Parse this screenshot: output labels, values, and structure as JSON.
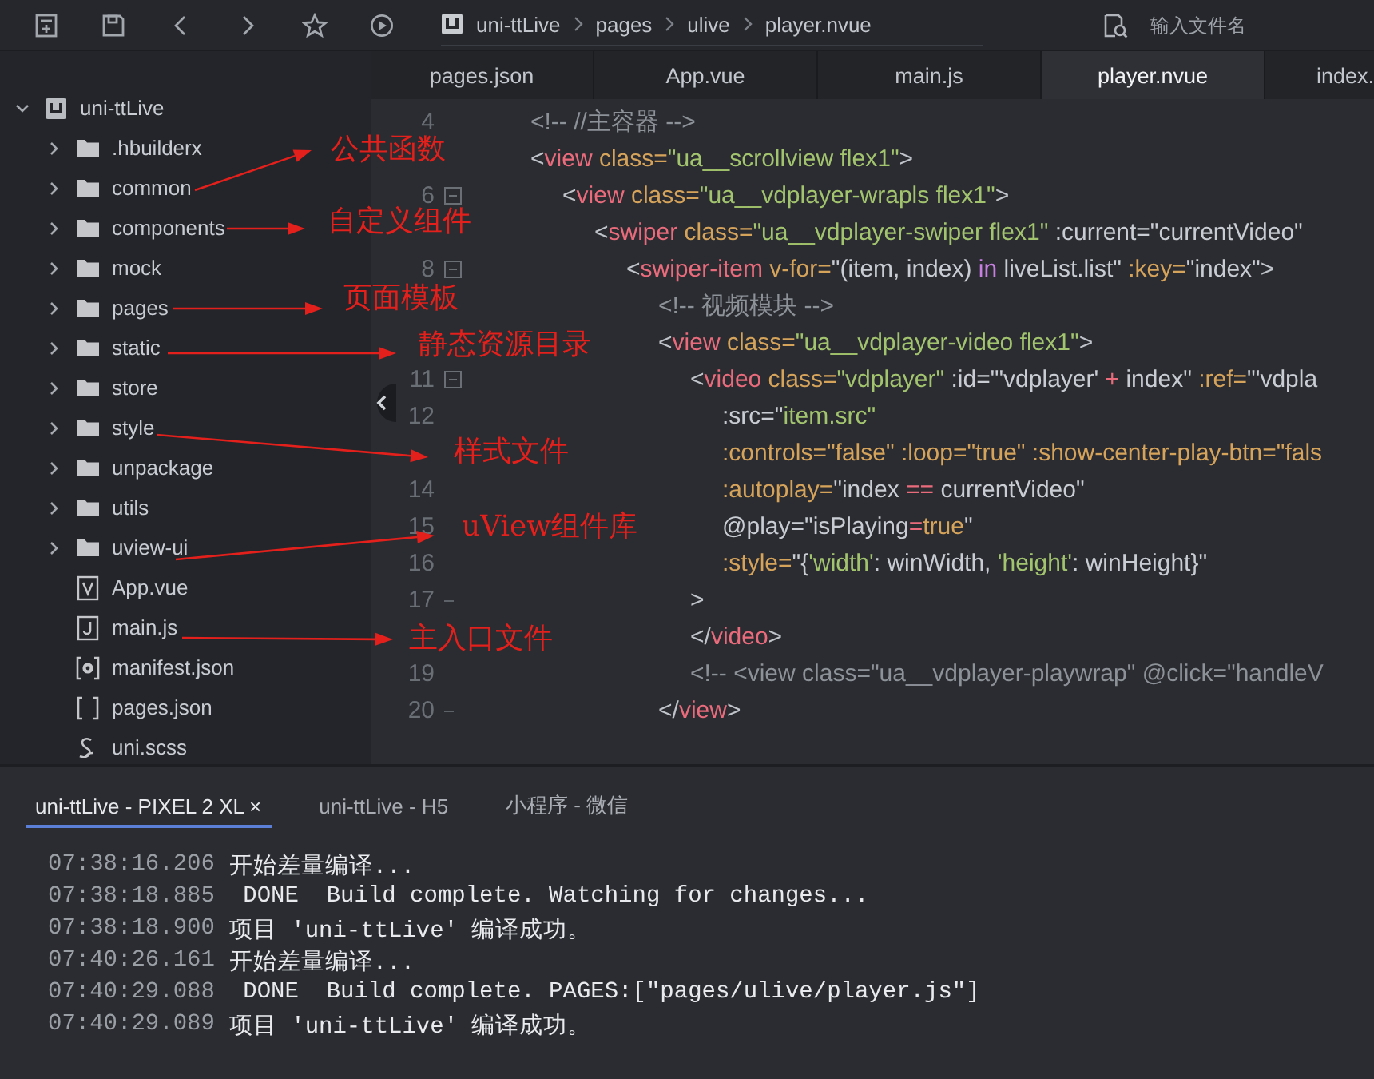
{
  "toolbar": {
    "breadcrumb": [
      "uni-ttLive",
      "pages",
      "ulive",
      "player.nvue"
    ],
    "search": {
      "placeholder": "输入文件名"
    }
  },
  "file_tree": {
    "name": "uni-ttLive",
    "kind": "project",
    "expanded": true,
    "children": [
      {
        "name": ".hbuilderx",
        "kind": "folder",
        "expanded": false
      },
      {
        "name": "common",
        "kind": "folder",
        "expanded": false
      },
      {
        "name": "components",
        "kind": "folder",
        "expanded": false
      },
      {
        "name": "mock",
        "kind": "folder",
        "expanded": false
      },
      {
        "name": "pages",
        "kind": "folder",
        "expanded": false
      },
      {
        "name": "static",
        "kind": "folder",
        "expanded": false
      },
      {
        "name": "store",
        "kind": "folder",
        "expanded": false
      },
      {
        "name": "style",
        "kind": "folder",
        "expanded": false
      },
      {
        "name": "unpackage",
        "kind": "folder",
        "expanded": false
      },
      {
        "name": "utils",
        "kind": "folder",
        "expanded": false
      },
      {
        "name": "uview-ui",
        "kind": "folder",
        "expanded": false
      },
      {
        "name": "App.vue",
        "kind": "vue"
      },
      {
        "name": "main.js",
        "kind": "js"
      },
      {
        "name": "manifest.json",
        "kind": "manifest"
      },
      {
        "name": "pages.json",
        "kind": "json"
      },
      {
        "name": "uni.scss",
        "kind": "scss"
      }
    ]
  },
  "editor_tabs": [
    {
      "label": "pages.json",
      "selected": false
    },
    {
      "label": "App.vue",
      "selected": false
    },
    {
      "label": "main.js",
      "selected": false
    },
    {
      "label": "player.nvue",
      "selected": true
    },
    {
      "label": "index.",
      "selected": false
    }
  ],
  "code_lines": [
    {
      "number": "4",
      "tokens": [
        {
          "kind": "comment",
          "text": "<!-- //主容器 -->"
        }
      ]
    },
    {
      "tokens": [
        {
          "kind": "punct",
          "text": "<"
        },
        {
          "kind": "tag",
          "text": "view"
        },
        {
          "kind": "attr",
          "text": " class="
        },
        {
          "kind": "str",
          "text": "\"ua__scrollview flex1\""
        },
        {
          "kind": "punct",
          "text": ">"
        }
      ],
      "children": [
        {
          "number": "6",
          "fold_open": true,
          "tokens": [
            {
              "kind": "punct",
              "text": "<"
            },
            {
              "kind": "tag",
              "text": "view"
            },
            {
              "kind": "attr",
              "text": " class="
            },
            {
              "kind": "str",
              "text": "\"ua__vdplayer-wrapls flex1\""
            },
            {
              "kind": "punct",
              "text": ">"
            }
          ],
          "children": [
            {
              "tokens": [
                {
                  "kind": "punct",
                  "text": "<"
                },
                {
                  "kind": "tag",
                  "text": "swiper"
                },
                {
                  "kind": "attr",
                  "text": " class="
                },
                {
                  "kind": "str",
                  "text": "\"ua__vdplayer-swiper flex1\""
                },
                {
                  "kind": "expr",
                  "text": " :current=\"currentVideo\""
                }
              ],
              "children": [
                {
                  "number": "8",
                  "fold_open": true,
                  "tokens": [
                    {
                      "kind": "punct",
                      "text": "<"
                    },
                    {
                      "kind": "tag",
                      "text": "swiper-item"
                    },
                    {
                      "kind": "attr",
                      "text": " v-for="
                    },
                    {
                      "kind": "expr",
                      "text": "\"(item, index) "
                    },
                    {
                      "kind": "kw",
                      "text": "in"
                    },
                    {
                      "kind": "expr",
                      "text": " liveList.list\""
                    },
                    {
                      "kind": "attr",
                      "text": " :key="
                    },
                    {
                      "kind": "expr",
                      "text": "\"index\""
                    },
                    {
                      "kind": "punct",
                      "text": ">"
                    }
                  ],
                  "children": [
                    {
                      "tokens": [
                        {
                          "kind": "comment",
                          "text": "<!-- 视频模块 -->"
                        }
                      ]
                    },
                    {
                      "tokens": [
                        {
                          "kind": "punct",
                          "text": "<"
                        },
                        {
                          "kind": "tag",
                          "text": "view"
                        },
                        {
                          "kind": "attr",
                          "text": " class="
                        },
                        {
                          "kind": "str",
                          "text": "\"ua__vdplayer-video flex1\""
                        },
                        {
                          "kind": "punct",
                          "text": ">"
                        }
                      ],
                      "children": [
                        {
                          "number": "11",
                          "fold_open": true,
                          "tokens": [
                            {
                              "kind": "punct",
                              "text": "<"
                            },
                            {
                              "kind": "tag",
                              "text": "video"
                            },
                            {
                              "kind": "attr",
                              "text": " class="
                            },
                            {
                              "kind": "str",
                              "text": "\"vdplayer\""
                            },
                            {
                              "kind": "expr",
                              "text": " :id=\"'vdplayer' "
                            },
                            {
                              "kind": "op",
                              "text": "+"
                            },
                            {
                              "kind": "expr",
                              "text": " index\""
                            },
                            {
                              "kind": "attr",
                              "text": " :ref="
                            },
                            {
                              "kind": "expr",
                              "text": "\"'vdpla"
                            }
                          ],
                          "children": [
                            {
                              "number": "12",
                              "tokens": [
                                {
                                  "kind": "expr",
                                  "text": ":src=\""
                                },
                                {
                                  "kind": "str",
                                  "text": "item.src\""
                                }
                              ]
                            },
                            {
                              "tokens": [
                                {
                                  "kind": "attr",
                                  "text": ":controls=\"false\" :loop=\"true\" :show-center-play-btn=\"fals"
                                }
                              ]
                            },
                            {
                              "number": "14",
                              "tokens": [
                                {
                                  "kind": "attr",
                                  "text": ":autoplay="
                                },
                                {
                                  "kind": "expr",
                                  "text": "\"index "
                                },
                                {
                                  "kind": "op",
                                  "text": "=="
                                },
                                {
                                  "kind": "expr",
                                  "text": " currentVideo\""
                                }
                              ]
                            },
                            {
                              "number": "15",
                              "tokens": [
                                {
                                  "kind": "expr",
                                  "text": "@play=\"isPlaying"
                                },
                                {
                                  "kind": "op",
                                  "text": "="
                                },
                                {
                                  "kind": "attr",
                                  "text": "true"
                                },
                                {
                                  "kind": "expr",
                                  "text": "\""
                                }
                              ]
                            },
                            {
                              "number": "16",
                              "tokens": [
                                {
                                  "kind": "attr",
                                  "text": ":style="
                                },
                                {
                                  "kind": "expr",
                                  "text": "\"{"
                                },
                                {
                                  "kind": "str",
                                  "text": "'width'"
                                },
                                {
                                  "kind": "expr",
                                  "text": ": winWidth, "
                                },
                                {
                                  "kind": "str",
                                  "text": "'height'"
                                },
                                {
                                  "kind": "expr",
                                  "text": ": winHeight}\""
                                }
                              ]
                            }
                          ]
                        },
                        {
                          "number": "17",
                          "fold_end": true,
                          "tokens": [
                            {
                              "kind": "punct",
                              "text": ">"
                            }
                          ]
                        },
                        {
                          "tokens": [
                            {
                              "kind": "punct",
                              "text": "</"
                            },
                            {
                              "kind": "tag",
                              "text": "video"
                            },
                            {
                              "kind": "punct",
                              "text": ">"
                            }
                          ]
                        },
                        {
                          "number": "19",
                          "tokens": [
                            {
                              "kind": "comment",
                              "text": "<!-- <view class=\"ua__vdplayer-playwrap\" @click=\"handleV"
                            }
                          ]
                        }
                      ]
                    },
                    {
                      "number": "20",
                      "fold_end": true,
                      "tokens": [
                        {
                          "kind": "punct",
                          "text": "</"
                        },
                        {
                          "kind": "tag",
                          "text": "view"
                        },
                        {
                          "kind": "punct",
                          "text": ">"
                        }
                      ]
                    }
                  ]
                }
              ]
            }
          ]
        }
      ]
    }
  ],
  "console": {
    "tabs": [
      {
        "label": "uni-ttLive - PIXEL 2 XL",
        "selected": true,
        "close": "×"
      },
      {
        "label": "uni-ttLive - H5",
        "selected": false
      },
      {
        "label": "小程序 - 微信",
        "selected": false
      }
    ],
    "lines": [
      {
        "time": "07:38:16.206",
        "message": "开始差量编译..."
      },
      {
        "time": "07:38:18.885",
        "message": " DONE  Build complete. Watching for changes..."
      },
      {
        "time": "07:38:18.900",
        "message": "项目 'uni-ttLive' 编译成功。"
      },
      {
        "time": "07:40:26.161",
        "message": "开始差量编译..."
      },
      {
        "time": "07:40:29.088",
        "message": " DONE  Build complete. PAGES:[\"pages/ulive/player.js\"]"
      },
      {
        "time": "07:40:29.089",
        "message": "项目 'uni-ttLive' 编译成功。"
      }
    ]
  },
  "annotations": [
    {
      "text": "公共函数"
    },
    {
      "text": "自定义组件"
    },
    {
      "text": "页面模板"
    },
    {
      "text": "静态资源目录"
    },
    {
      "text": "样式文件"
    },
    {
      "text": "uView组件库"
    },
    {
      "text": "主入口文件"
    }
  ]
}
